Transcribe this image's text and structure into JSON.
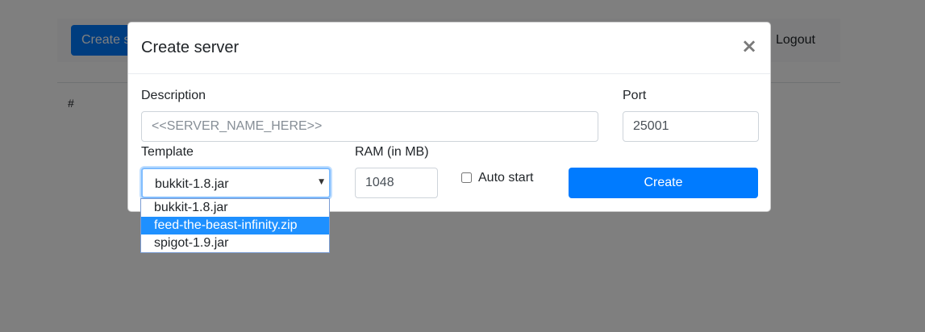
{
  "page": {
    "create_button_label": "Create server",
    "logout_label": "Logout",
    "table_header_hash": "#"
  },
  "modal": {
    "title": "Create server",
    "close_symbol": "×",
    "description_label": "Description",
    "description_placeholder": "<<SERVER_NAME_HERE>>",
    "description_value": "",
    "port_label": "Port",
    "port_value": "25001",
    "template_label": "Template",
    "template_selected": "bukkit-1.8.jar",
    "template_options": [
      "bukkit-1.8.jar",
      "feed-the-beast-infinity.zip",
      "spigot-1.9.jar"
    ],
    "template_highlighted_index": 1,
    "ram_label": "RAM (in MB)",
    "ram_value": "1048",
    "auto_start_label": "Auto start",
    "auto_start_checked": false,
    "create_label": "Create"
  },
  "colors": {
    "primary": "#007bff",
    "option_highlight": "#1e90ff",
    "backdrop": "rgba(0,0,0,0.5)"
  },
  "icons": {
    "close": "close-icon",
    "select_arrow": "chevron-down-icon"
  }
}
